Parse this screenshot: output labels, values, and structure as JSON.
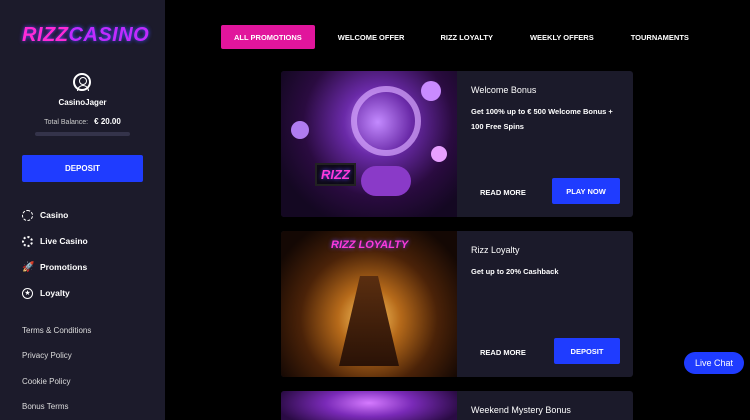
{
  "brand": {
    "logo_part1": "RIZZ",
    "logo_part2": "CASINO"
  },
  "user": {
    "name": "CasinoJager",
    "balance_label": "Total Balance:",
    "balance_value": "€ 20.00"
  },
  "sidebar": {
    "deposit_label": "DEPOSIT",
    "nav": [
      {
        "label": "Casino",
        "icon": "casino-chip-icon"
      },
      {
        "label": "Live Casino",
        "icon": "live-casino-chip-icon"
      },
      {
        "label": "Promotions",
        "icon": "rocket-icon"
      },
      {
        "label": "Loyalty",
        "icon": "star-icon"
      }
    ],
    "links": [
      "Terms & Conditions",
      "Privacy Policy",
      "Cookie Policy",
      "Bonus Terms"
    ]
  },
  "tabs": [
    {
      "label": "ALL PROMOTIONS",
      "active": true
    },
    {
      "label": "WELCOME OFFER",
      "active": false
    },
    {
      "label": "RIZZ LOYALTY",
      "active": false
    },
    {
      "label": "WEEKLY OFFERS",
      "active": false
    },
    {
      "label": "TOURNAMENTS",
      "active": false
    }
  ],
  "promos": [
    {
      "title": "Welcome Bonus",
      "desc": "Get 100% up to € 500 Welcome Bonus + 100 Free Spins",
      "more": "READ MORE",
      "cta": "PLAY NOW",
      "img_text": "RIZZ"
    },
    {
      "title": "Rizz Loyalty",
      "desc": "Get up to 20% Cashback",
      "more": "READ MORE",
      "cta": "DEPOSIT",
      "img_text": "RIZZ LOYALTY"
    },
    {
      "title": "Weekend Mystery Bonus",
      "desc": "",
      "more": "",
      "cta": ""
    }
  ],
  "live_chat_label": "Live Chat",
  "colors": {
    "accent_pink": "#e1159c",
    "primary_blue": "#1f3cff",
    "sidebar_bg": "#1c1b2b",
    "card_bg": "#1b1a2a"
  }
}
